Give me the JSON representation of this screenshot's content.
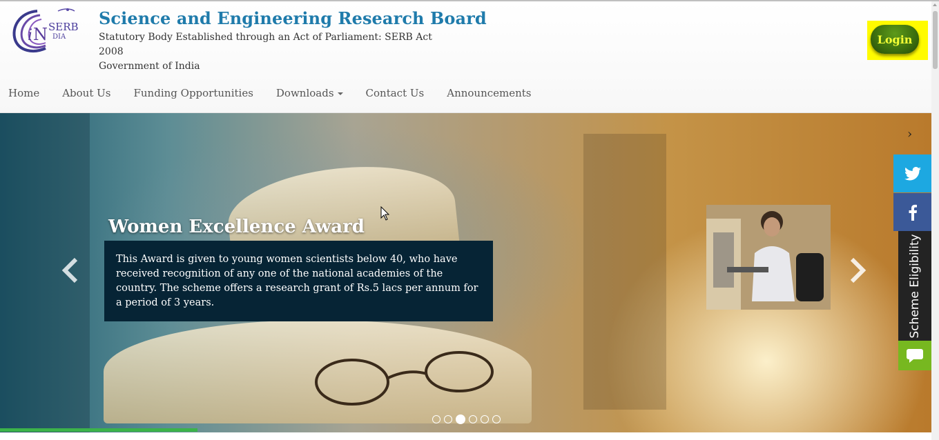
{
  "header": {
    "logo_text": "SERB",
    "logo_sub": "iN DIA",
    "title": "Science and Engineering Research Board",
    "subtitle_line1": "Statutory Body Established through an Act of Parliament: SERB Act",
    "subtitle_line2": "2008",
    "subtitle_line3": "Government of India",
    "login_label": "Login"
  },
  "nav": {
    "items": [
      {
        "label": "Home"
      },
      {
        "label": "About Us"
      },
      {
        "label": "Funding Opportunities"
      },
      {
        "label": "Downloads"
      },
      {
        "label": "Contact Us"
      },
      {
        "label": "Announcements"
      }
    ]
  },
  "slider": {
    "title": "Women Excellence Award",
    "text": "This Award is given to young women scientists below 40, who have received recognition of any one of the national academies of the country. The scheme offers a research grant of Rs.5 lacs per annum for a period of 3 years.",
    "active_slide": 3,
    "total_slides": 6,
    "progress_percent": 21
  },
  "side": {
    "scheme_label": "Scheme Eligibility"
  },
  "colors": {
    "title_blue": "#1f7bab",
    "login_highlight": "#fffb00",
    "login_green": "#3c6e0e",
    "twitter": "#1da8e1",
    "facebook": "#3b5998",
    "chat_green": "#77b820",
    "progress_green": "#3cb34a"
  },
  "icons": [
    "serb-logo",
    "chevron-left-icon",
    "chevron-right-icon",
    "twitter-icon",
    "facebook-icon",
    "chat-icon",
    "caret-down-icon",
    "cursor-icon"
  ]
}
